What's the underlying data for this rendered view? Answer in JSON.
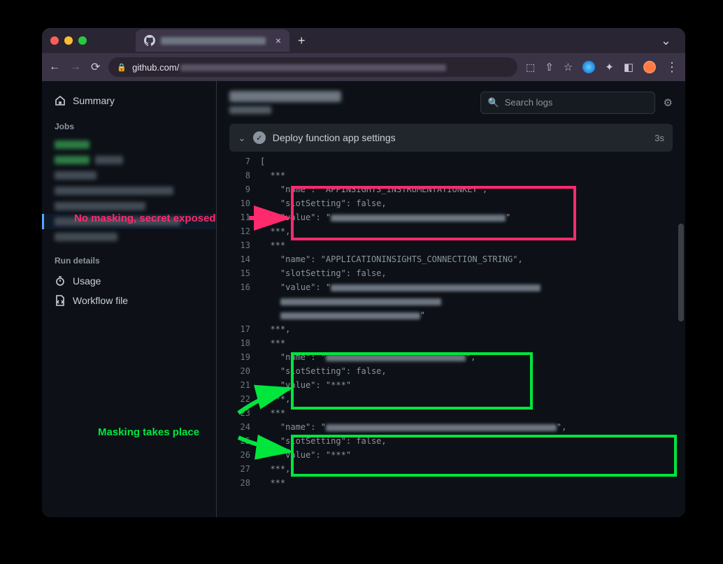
{
  "browser": {
    "tab_title_redacted": true,
    "url_host": "github.com/",
    "new_tab": "+"
  },
  "sidebar": {
    "summary": "Summary",
    "jobs_header": "Jobs",
    "run_details_header": "Run details",
    "usage": "Usage",
    "workflow_file": "Workflow file"
  },
  "header": {
    "search_placeholder": "Search logs"
  },
  "step": {
    "title": "Deploy function app settings",
    "duration": "3s"
  },
  "annotations": {
    "no_masking": "No masking, secret exposed",
    "masking": "Masking takes place"
  },
  "log_lines": [
    {
      "n": 7,
      "t": "["
    },
    {
      "n": 8,
      "t": "  ***"
    },
    {
      "n": 9,
      "t": "    \"name\": \"APPINSIGHTS_INSTRUMENTATIONKEY\","
    },
    {
      "n": 10,
      "t": "    \"slotSetting\": false,"
    },
    {
      "n": 11,
      "t": "    \"value\": \"",
      "blur_after": 250,
      "tail": "\""
    },
    {
      "n": 12,
      "t": "  ***,"
    },
    {
      "n": 13,
      "t": "  ***"
    },
    {
      "n": 14,
      "t": "    \"name\": \"APPLICATIONINSIGHTS_CONNECTION_STRING\","
    },
    {
      "n": 15,
      "t": "    \"slotSetting\": false,"
    },
    {
      "n": 16,
      "t": "    \"value\": \"",
      "blur_after": 300,
      "tail": ""
    },
    {
      "n": "",
      "t": "",
      "blur_only": 230
    },
    {
      "n": "",
      "t": "",
      "blur_only": 200,
      "tail": "\""
    },
    {
      "n": 17,
      "t": "  ***,"
    },
    {
      "n": 18,
      "t": "  ***"
    },
    {
      "n": 19,
      "t": "    \"name\": \"",
      "blur_after": 200,
      "tail": "\","
    },
    {
      "n": 20,
      "t": "    \"slotSetting\": false,"
    },
    {
      "n": 21,
      "t": "    \"value\": \"***\""
    },
    {
      "n": 22,
      "t": "  ***,"
    },
    {
      "n": 23,
      "t": "  ***"
    },
    {
      "n": 24,
      "t": "    \"name\": \"",
      "blur_after": 330,
      "tail": "\","
    },
    {
      "n": 25,
      "t": "    \"slotSetting\": false,"
    },
    {
      "n": 26,
      "t": "    \"value\": \"***\""
    },
    {
      "n": 27,
      "t": "  ***,"
    },
    {
      "n": 28,
      "t": "  ***"
    }
  ]
}
